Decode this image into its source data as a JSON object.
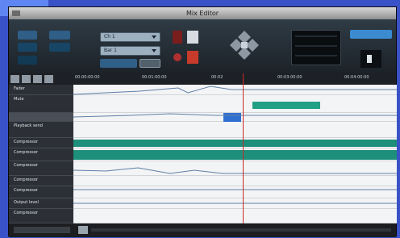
{
  "window": {
    "title": "Mix Editor"
  },
  "toolbar": {
    "left_buttons": [
      "",
      "",
      "",
      "",
      ""
    ],
    "selector_1": "Ch 1",
    "selector_2": "Bar 1",
    "mode_button": "",
    "small_button": "",
    "right_button": ""
  },
  "navbar": {
    "ticks": [
      "00:00:00:00",
      "00:01:00:00",
      "00:02",
      "00:03:00:00",
      "00:04:00:00"
    ]
  },
  "tracks": [
    "Fader",
    "Mute",
    "",
    "Playback send",
    "Compressor",
    "Compressor",
    "Compressor",
    "Compressor",
    "Compressor",
    "Output level",
    "Compressor"
  ],
  "colors": {
    "accent": "#22a086",
    "accent_dark": "#1d8f7a",
    "selection": "#2f6fd0"
  }
}
